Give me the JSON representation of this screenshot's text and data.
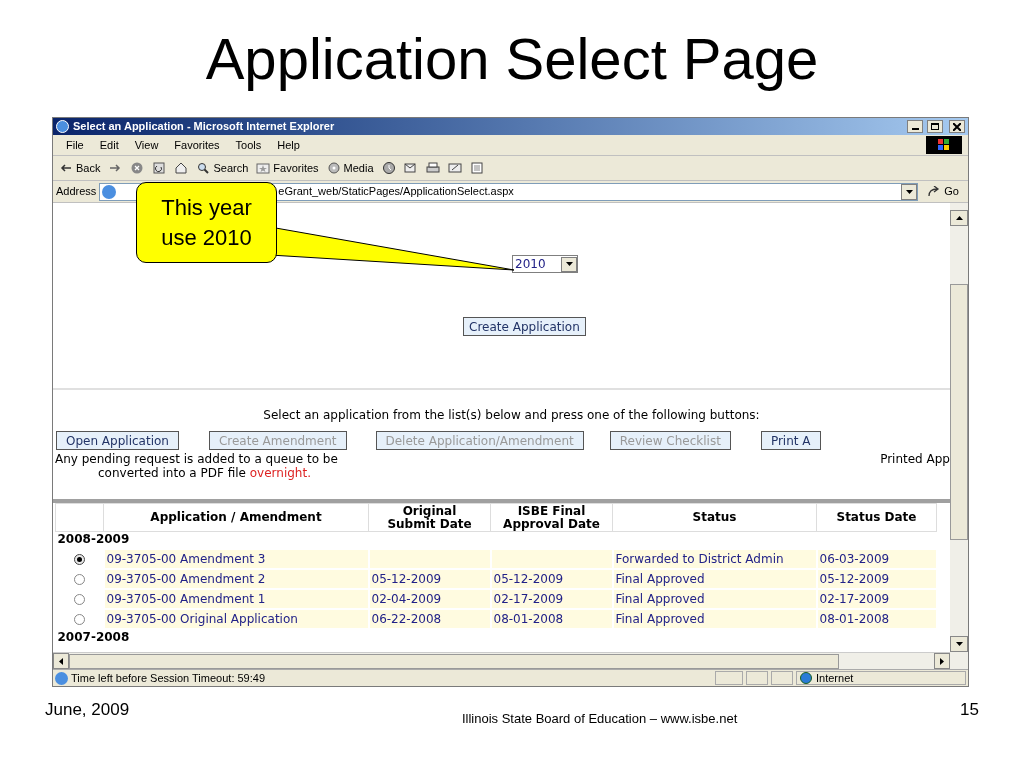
{
  "slide": {
    "title": "Application Select Page",
    "footer_date": "June, 2009",
    "footer_center": "Illinois State Board of Education – www.isbe.net",
    "page_number": "15"
  },
  "window": {
    "title": "Select an Application - Microsoft Internet Explorer"
  },
  "menu": [
    "File",
    "Edit",
    "View",
    "Favorites",
    "Tools",
    "Help"
  ],
  "toolbar": [
    {
      "kind": "back",
      "label": "Back"
    },
    {
      "kind": "forward"
    },
    {
      "kind": "stop"
    },
    {
      "kind": "refresh"
    },
    {
      "kind": "home"
    },
    {
      "kind": "search",
      "label": "Search"
    },
    {
      "kind": "favorites",
      "label": "Favorites"
    },
    {
      "kind": "media",
      "label": "Media"
    },
    {
      "kind": "history"
    },
    {
      "kind": "mail"
    },
    {
      "kind": "print"
    },
    {
      "kind": "edit"
    },
    {
      "kind": "discuss"
    }
  ],
  "address": {
    "label": "Address",
    "value": "eGrant_web/StaticPages/ApplicationSelect.aspx",
    "go": "Go"
  },
  "callout": {
    "text": "This year use 2010"
  },
  "year_select": {
    "value": "2010"
  },
  "create_button": "Create Application",
  "instructions": "Select an application from the list(s) below and press one of the following buttons:",
  "action_buttons": [
    {
      "label": "Open Application",
      "disabled": false
    },
    {
      "label": "Create Amendment",
      "disabled": true
    },
    {
      "label": "Delete Application/Amendment",
      "disabled": true
    },
    {
      "label": "Review Checklist",
      "disabled": true
    },
    {
      "label": "Print A",
      "disabled": false
    }
  ],
  "pending_note": {
    "lines": [
      "Any pending request is added to a queue to be",
      "converted into a PDF file"
    ],
    "highlight": "overnight."
  },
  "print_note": "Printed App",
  "table": {
    "columns": [
      "Application / Amendment",
      "Original Submit Date",
      "ISBE Final Approval Date",
      "Status",
      "Status Date"
    ],
    "groups": [
      {
        "label": "2008-2009",
        "rows": [
          {
            "selected": true,
            "cells": [
              "09-3705-00 Amendment 3",
              "",
              "",
              "Forwarded to District Admin",
              "06-03-2009"
            ]
          },
          {
            "selected": false,
            "cells": [
              "09-3705-00 Amendment 2",
              "05-12-2009",
              "05-12-2009",
              "Final Approved",
              "05-12-2009"
            ]
          },
          {
            "selected": false,
            "cells": [
              "09-3705-00 Amendment 1",
              "02-04-2009",
              "02-17-2009",
              "Final Approved",
              "02-17-2009"
            ]
          },
          {
            "selected": false,
            "cells": [
              "09-3705-00 Original Application",
              "06-22-2008",
              "08-01-2008",
              "Final Approved",
              "08-01-2008"
            ]
          }
        ]
      },
      {
        "label": "2007-2008"
      }
    ]
  },
  "status_bar": {
    "text": "Time left before Session Timeout: 59:49",
    "zone": "Internet"
  }
}
